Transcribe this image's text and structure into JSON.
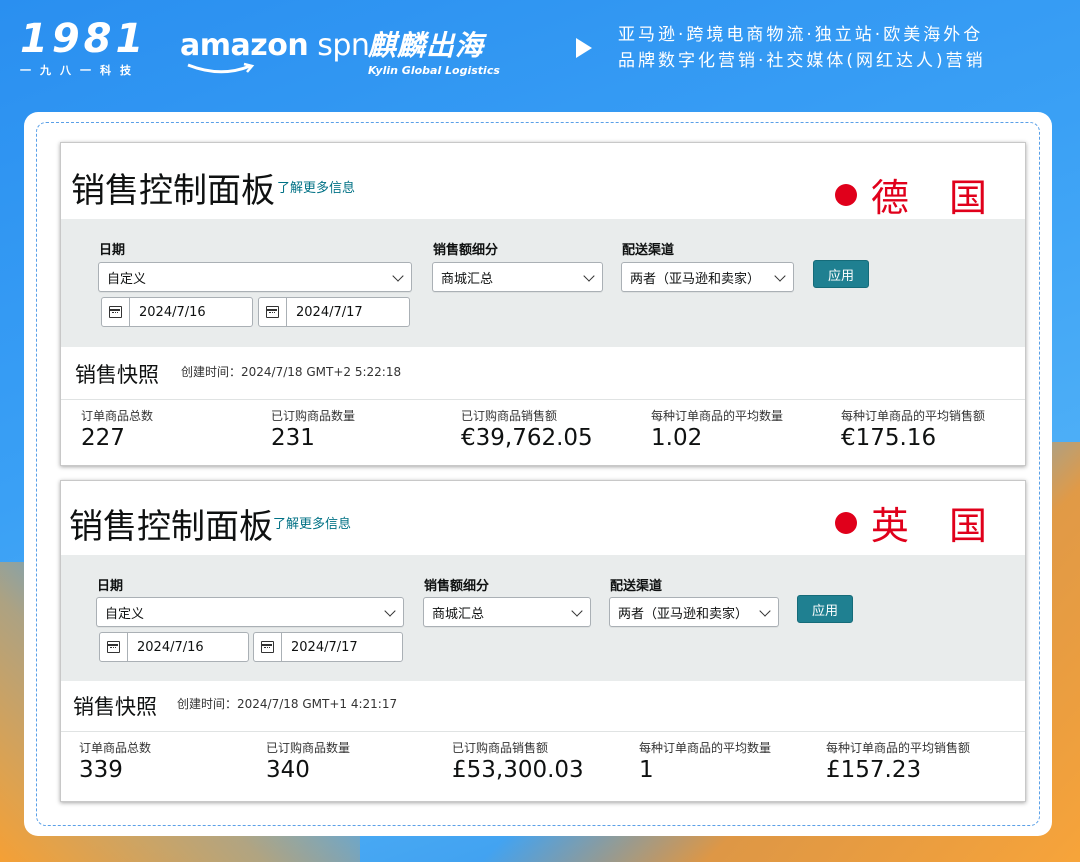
{
  "header": {
    "logo_number": "1981",
    "logo_sub": "一九八一科技",
    "amazon_text": "amazon",
    "amazon_spn": " spn",
    "kylin_cn": "麒麟出海",
    "kylin_en": "Kylin Global Logistics",
    "tagline_line1": "亚马逊·跨境电商物流·独立站·欧美海外仓",
    "tagline_line2": "品牌数字化营销·社交媒体(网红达人)营销"
  },
  "panels": [
    {
      "country": "德 国",
      "title": "销售控制面板",
      "learn_more": "了解更多信息",
      "filters": {
        "date_label": "日期",
        "date_range": "自定义",
        "start_date": "2024/7/16",
        "end_date": "2024/7/17",
        "breakdown_label": "销售额细分",
        "breakdown_value": "商城汇总",
        "channel_label": "配送渠道",
        "channel_value": "两者（亚马逊和卖家）",
        "apply": "应用"
      },
      "snapshot": {
        "title": "销售快照",
        "created": "创建时间：2024/7/18 GMT+2 5:22:18",
        "metrics": [
          {
            "label": "订单商品总数",
            "value": "227"
          },
          {
            "label": "已订购商品数量",
            "value": "231"
          },
          {
            "label": "已订购商品销售额",
            "value": "€39,762.05"
          },
          {
            "label": "每种订单商品的平均数量",
            "value": "1.02"
          },
          {
            "label": "每种订单商品的平均销售额",
            "value": "€175.16"
          }
        ]
      }
    },
    {
      "country": "英 国",
      "title": "销售控制面板",
      "learn_more": "了解更多信息",
      "filters": {
        "date_label": "日期",
        "date_range": "自定义",
        "start_date": "2024/7/16",
        "end_date": "2024/7/17",
        "breakdown_label": "销售额细分",
        "breakdown_value": "商城汇总",
        "channel_label": "配送渠道",
        "channel_value": "两者（亚马逊和卖家）",
        "apply": "应用"
      },
      "snapshot": {
        "title": "销售快照",
        "created": "创建时间：2024/7/18 GMT+1 4:21:17",
        "metrics": [
          {
            "label": "订单商品总数",
            "value": "339"
          },
          {
            "label": "已订购商品数量",
            "value": "340"
          },
          {
            "label": "已订购商品销售额",
            "value": "£53,300.03"
          },
          {
            "label": "每种订单商品的平均数量",
            "value": "1"
          },
          {
            "label": "每种订单商品的平均销售额",
            "value": "£157.23"
          }
        ]
      }
    }
  ],
  "colors": {
    "accent_red": "#e0001b",
    "link_teal": "#007185",
    "button_teal": "#1f8091",
    "background_blue": "#3aa0f5"
  }
}
